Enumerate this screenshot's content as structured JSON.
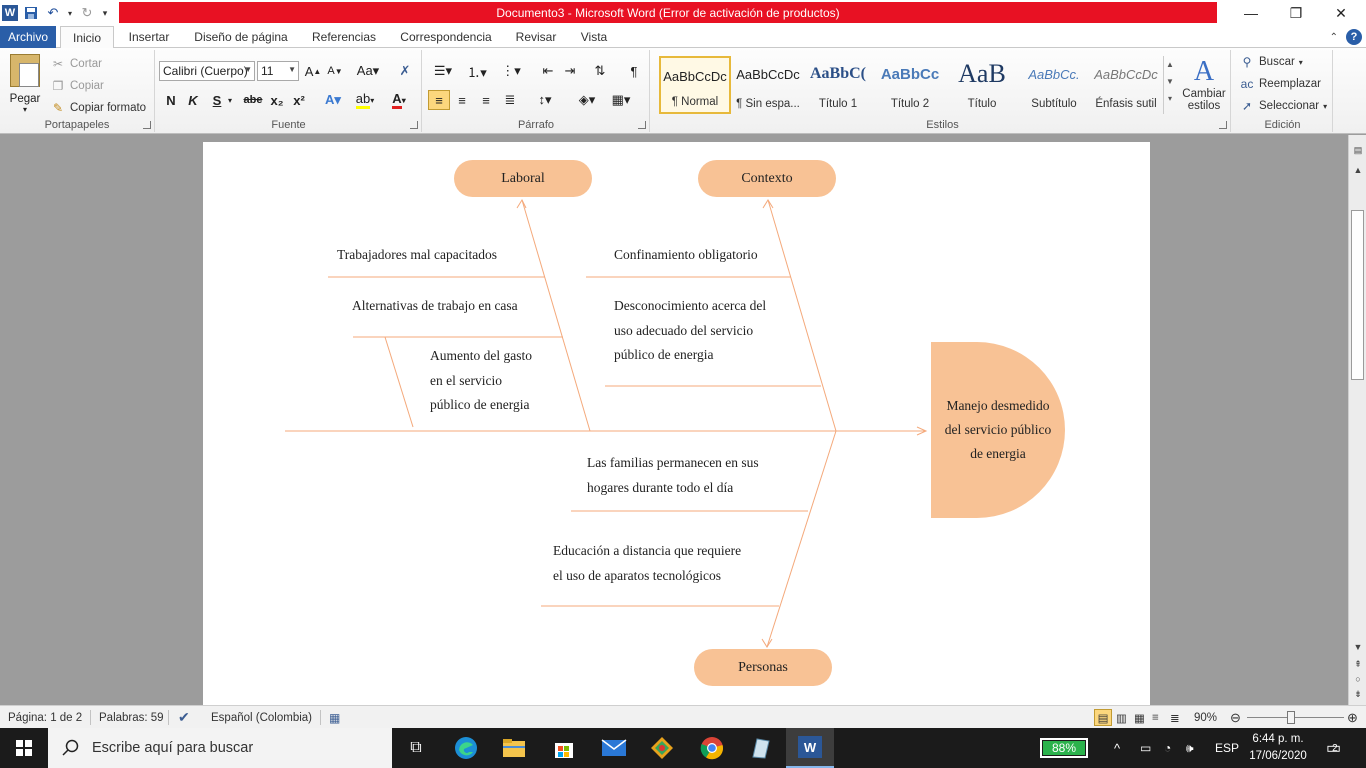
{
  "window": {
    "title": "Documento3 -  Microsoft Word (Error de activación de productos)",
    "minimize": "—",
    "maximize": "❐",
    "close": "✕"
  },
  "tabs": [
    {
      "label": "Archivo"
    },
    {
      "label": "Inicio"
    },
    {
      "label": "Insertar"
    },
    {
      "label": "Diseño de página"
    },
    {
      "label": "Referencias"
    },
    {
      "label": "Correspondencia"
    },
    {
      "label": "Revisar"
    },
    {
      "label": "Vista"
    }
  ],
  "ribbon": {
    "clipboard": {
      "group_label": "Portapapeles",
      "paste": "Pegar",
      "cut": "Cortar",
      "copy": "Copiar",
      "format_painter": "Copiar formato"
    },
    "font": {
      "group_label": "Fuente",
      "font_name": "Calibri (Cuerpo)",
      "font_size": "11",
      "bold": "N",
      "italic": "K",
      "underline": "S",
      "strike": "abe",
      "subscript": "x₂",
      "superscript": "x²"
    },
    "paragraph": {
      "group_label": "Párrafo"
    },
    "styles": {
      "group_label": "Estilos",
      "items": [
        {
          "sample": "AaBbCcDc",
          "name": "¶ Normal"
        },
        {
          "sample": "AaBbCcDc",
          "name": "¶ Sin espa..."
        },
        {
          "sample": "AaBbC(",
          "name": "Título 1"
        },
        {
          "sample": "AaBbCc",
          "name": "Título 2"
        },
        {
          "sample": "AaB",
          "name": "Título"
        },
        {
          "sample": "AaBbCc.",
          "name": "Subtítulo"
        },
        {
          "sample": "AaBbCcDc",
          "name": "Énfasis sutil"
        }
      ],
      "change_styles": "Cambiar",
      "change_styles_2": "estilos"
    },
    "editing": {
      "group_label": "Edición",
      "find": "Buscar",
      "replace": "Reemplazar",
      "select": "Seleccionar"
    }
  },
  "diagram": {
    "effect": "Manejo desmedido del servicio público de energia",
    "categories": {
      "laboral": "Laboral",
      "contexto": "Contexto",
      "personas": "Personas"
    },
    "causes": {
      "laboral_1": "Trabajadores  mal  capacitados",
      "laboral_2": "Alternativas  de  trabajo  en casa",
      "laboral_3_l1": "Aumento  del gasto",
      "laboral_3_l2": "en  el  servicio",
      "laboral_3_l3": "público  de energia",
      "contexto_1": "Confinamiento  obligatorio",
      "contexto_2_l1": "Desconocimiento  acerca del",
      "contexto_2_l2": "uso  adecuado  del  servicio",
      "contexto_2_l3": "público  de energia",
      "personas_1_l1": "Las  familias  permanecen  en sus",
      "personas_1_l2": "hogares  durante  todo  el  día",
      "personas_2_l1": "Educación  a distancia  que requiere",
      "personas_2_l2": "el uso  de  aparatos  tecnológicos"
    },
    "colors": {
      "shape_fill": "#f8c295",
      "line": "#f4a97b"
    }
  },
  "statusbar": {
    "page": "Página: 1 de 2",
    "words": "Palabras: 59",
    "language": "Español (Colombia)",
    "zoom": "90%"
  },
  "taskbar": {
    "search_placeholder": "Escribe aquí para buscar",
    "battery": "88%",
    "lang": "ESP",
    "time": "6:44 p. m.",
    "date": "17/06/2020",
    "notifications": "2"
  }
}
